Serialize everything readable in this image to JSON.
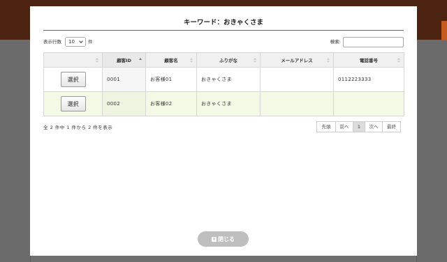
{
  "dialog": {
    "title": "キーワード：おきゃくさま",
    "close_label": "閉じる"
  },
  "controls": {
    "page_length_label": "表示行数",
    "page_length_value": "10",
    "page_length_unit": "件",
    "search_label": "検索:",
    "search_value": ""
  },
  "table": {
    "columns": [
      "",
      "顧客ID",
      "顧客名",
      "ふりがな",
      "メールアドレス",
      "電話番号"
    ],
    "sort": {
      "column": "顧客ID",
      "direction": "ascending"
    },
    "rows": [
      {
        "select_label": "選択",
        "id": "0001",
        "name": "お客様01",
        "kana": "おきゃくさま",
        "email": "",
        "phone": "0112223333"
      },
      {
        "select_label": "選択",
        "id": "0002",
        "name": "お客様02",
        "kana": "おきゃくさま",
        "email": "",
        "phone": ""
      }
    ]
  },
  "info": "全 2 件中 1 件から 2 件を表示",
  "pagination": {
    "first": "先頭",
    "prev": "前へ",
    "current": "1",
    "next": "次へ",
    "last": "最終"
  },
  "icons": {
    "dropdown": "chevron-down-icon",
    "sort": "sort-icon",
    "sort_active": "sort-ascending-icon",
    "close": "close-icon"
  },
  "colors": {
    "page_header": "#4b2310",
    "header_accent": "#c45a1c",
    "dialog_bg": "#ffffff",
    "row_alt_bg": "#f4f9e6",
    "close_button_bg": "#bebebe"
  }
}
